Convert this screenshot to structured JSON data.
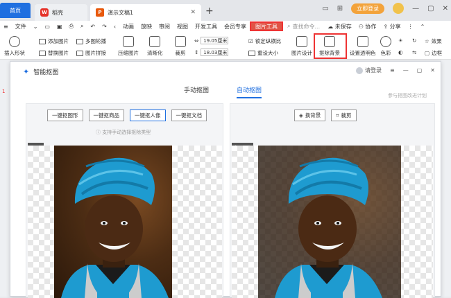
{
  "titlebar": {
    "home_tab": "首页",
    "wps_tab": "稻壳",
    "doc_tab": "演示文稿1",
    "login_button": "立即登录"
  },
  "menubar": {
    "file": "文件",
    "items": [
      "动画",
      "放映",
      "审阅",
      "视图",
      "开发工具",
      "会员专享",
      "图片工具"
    ],
    "search_placeholder": "查找命令...",
    "unsaved": "未保存",
    "collab": "协作",
    "share": "分享"
  },
  "toolbar": {
    "insert_shape": "插入形状",
    "add_picture": "添加图片",
    "replace_picture": "替换图片",
    "multi_round": "多图轮播",
    "picture_collage": "图片拼接",
    "compress": "压缩图片",
    "sharpen": "清晰化",
    "crop": "裁剪",
    "width": "19.05厘米",
    "height": "18.03厘米",
    "lock_ratio": "锁定纵横比",
    "reset_size": "重设大小",
    "picture_design": "图片设计",
    "remove_bg": "抠除背景",
    "set_transparent": "设置透明色",
    "color": "色彩",
    "effects": "效果",
    "border": "边框"
  },
  "dialog": {
    "title": "智能抠图",
    "login": "请登录",
    "tab_manual": "手动抠图",
    "tab_auto": "自动抠图",
    "feedback": "参与抠图改进计划",
    "left_buttons": [
      "一键抠图形",
      "一键抠商品",
      "一键抠人像",
      "一键抠文档"
    ],
    "hint": "支持手动选择抠除类型",
    "right_buttons": [
      "换背景",
      "裁剪"
    ],
    "label_original": "原图",
    "label_result": "抠图后"
  },
  "colors": {
    "accent": "#1f6fe0",
    "highlight_red": "#e33",
    "turban_blue": "#1e9bd0"
  }
}
